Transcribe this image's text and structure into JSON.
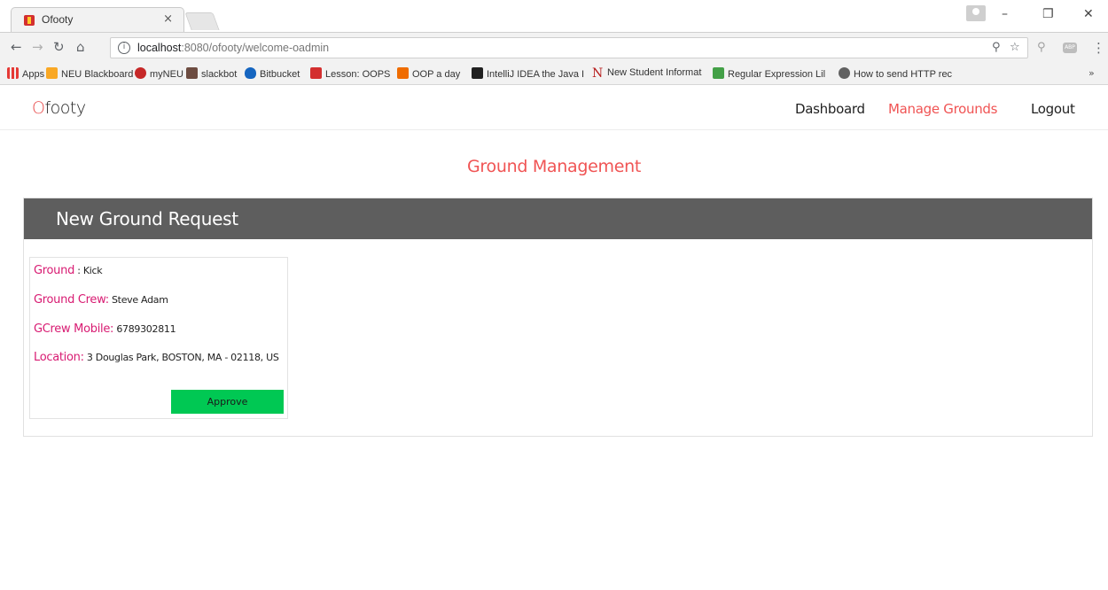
{
  "browser": {
    "tab_title": "Ofooty",
    "tab_close": "×",
    "url_host": "localhost",
    "url_rest": ":8080/ofooty/welcome-oadmin",
    "bookmarks": [
      {
        "label": "Apps",
        "color": "#e53935"
      },
      {
        "label": "NEU Blackboard",
        "color": "#f9a825"
      },
      {
        "label": "myNEU",
        "color": "#c62828"
      },
      {
        "label": "slackbot",
        "color": "#6d4c41"
      },
      {
        "label": "Bitbucket",
        "color": "#1565c0"
      },
      {
        "label": "Lesson: OOPS",
        "color": "#d32f2f"
      },
      {
        "label": "OOP a day",
        "color": "#ef6c00"
      },
      {
        "label": "IntelliJ IDEA the Java I",
        "color": "#212121"
      },
      {
        "label": "New Student Informat",
        "color": "#b71c1c"
      },
      {
        "label": "Regular Expression Lil",
        "color": "#43a047"
      },
      {
        "label": "How to send HTTP rec",
        "color": "#616161"
      }
    ],
    "bookmarks_more": "»"
  },
  "navbar": {
    "brand_first": "O",
    "brand_rest": "footy",
    "links": [
      "Dashboard",
      "Manage Grounds",
      "Logout"
    ]
  },
  "page": {
    "heading": "Ground Management",
    "panel_title": "New Ground Request",
    "card": {
      "ground_label": "Ground",
      "ground_value": ": Kick",
      "crew_label": "Ground Crew:",
      "crew_value": "Steve Adam",
      "mobile_label": "GCrew Mobile:",
      "mobile_value": "6789302811",
      "location_label": "Location:",
      "location_value": "3 Douglas Park, BOSTON, MA - 02118, US",
      "approve_label": "Approve"
    }
  },
  "colors": {
    "accent": "#f05454",
    "label_pink": "#d81b72",
    "panel_header": "#5e5e5e",
    "approve_green": "#00c853"
  }
}
